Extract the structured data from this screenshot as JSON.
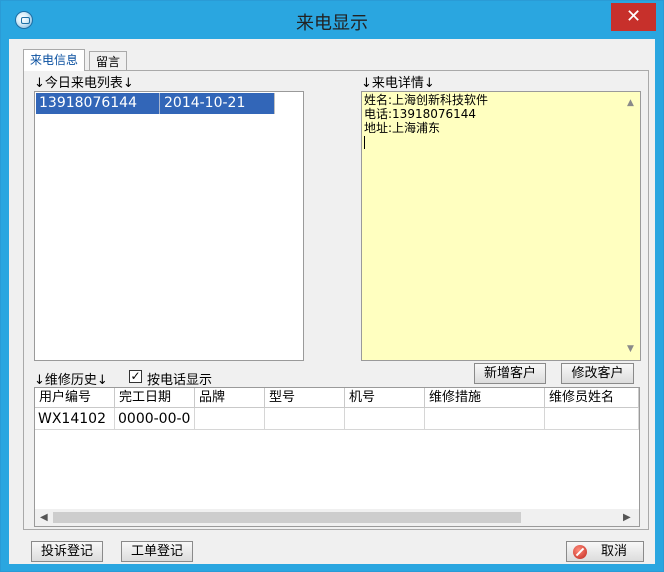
{
  "window": {
    "title": "来电显示",
    "close_label": "✕"
  },
  "tabs": [
    {
      "label": "来电信息",
      "active": true
    },
    {
      "label": "留言",
      "active": false
    }
  ],
  "today_calls": {
    "label": "↓今日来电列表↓",
    "rows": [
      {
        "phone": "13918076144",
        "date": "2014-10-21"
      }
    ]
  },
  "call_detail": {
    "label": "↓来电详情↓",
    "text": "姓名:上海创新科技软件\n电话:13918076144\n地址:上海浦东"
  },
  "buttons": {
    "add_customer": "新增客户",
    "edit_customer": "修改客户",
    "complaint": "投诉登记",
    "work_order": "工单登记",
    "cancel": "取消"
  },
  "repair_history": {
    "label": "↓维修历史↓",
    "filter_label": "按电话显示",
    "filter_checked": true,
    "columns": [
      "用户编号",
      "完工日期",
      "品牌",
      "型号",
      "机号",
      "维修措施",
      "维修员姓名"
    ],
    "rows": [
      [
        "WX14102",
        "0000-00-0",
        "",
        "",
        "",
        "",
        ""
      ]
    ]
  }
}
